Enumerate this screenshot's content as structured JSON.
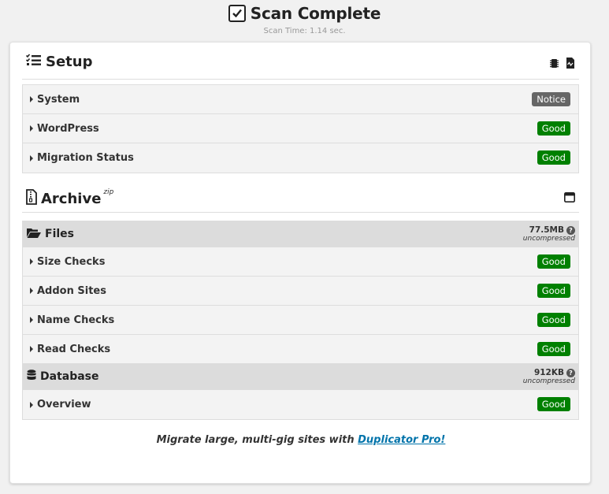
{
  "header": {
    "title": "Scan Complete",
    "scan_time": "Scan Time: 1.14 sec."
  },
  "setup": {
    "title": "Setup",
    "items": [
      {
        "label": "System",
        "status": "Notice"
      },
      {
        "label": "WordPress",
        "status": "Good"
      },
      {
        "label": "Migration Status",
        "status": "Good"
      }
    ]
  },
  "archive": {
    "title": "Archive",
    "format": "zip",
    "files": {
      "title": "Files",
      "size": "77.5MB",
      "size_note": "uncompressed",
      "items": [
        {
          "label": "Size Checks",
          "status": "Good"
        },
        {
          "label": "Addon Sites",
          "status": "Good"
        },
        {
          "label": "Name Checks",
          "status": "Good"
        },
        {
          "label": "Read Checks",
          "status": "Good"
        }
      ]
    },
    "database": {
      "title": "Database",
      "size": "912KB",
      "size_note": "uncompressed",
      "items": [
        {
          "label": "Overview",
          "status": "Good"
        }
      ]
    }
  },
  "promo": {
    "text": "Migrate large, multi-gig sites with ",
    "link": "Duplicator Pro!"
  },
  "colors": {
    "good": "#008000",
    "notice": "#666666",
    "link": "#0073aa"
  }
}
